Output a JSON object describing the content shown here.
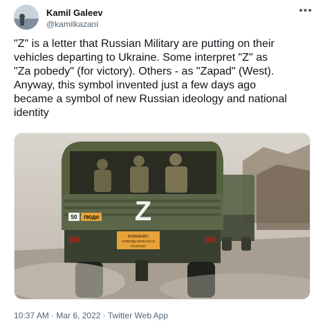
{
  "user": {
    "display_name": "Kamil Galeev",
    "handle": "@kamilkazani"
  },
  "more_icon": "more-horizontal-icon",
  "tweet": {
    "text": "\"Z\" is a letter that Russian Military are putting on their\nvehicles departing to Ukraine. Some interpret \"Z\" as\n\"Za pobedy\" (for victory). Others - as \"Zapad\" (West).\nAnyway, this symbol invented just a few days ago\nbecame a symbol of new Russian ideology and national\nidentity"
  },
  "media": {
    "truck_marking": "Z",
    "plate_sign": "ЛЮДИ",
    "plate_number": "50",
    "rear_sign_line1": "ВНИМАНИЕ!",
    "rear_sign_line2": "ОТВЕРДИ ВОИНСКАЯ",
    "rear_sign_line3": "КОЛОННА"
  },
  "footer": {
    "time": "10:37 AM",
    "sep1": " · ",
    "date": "Mar 6, 2022",
    "sep2": " · ",
    "source": "Twitter Web App"
  },
  "colors": {
    "truck_green": "#4f5a3e",
    "sign_orange": "#e8a23a",
    "secondary_text": "#536471"
  }
}
